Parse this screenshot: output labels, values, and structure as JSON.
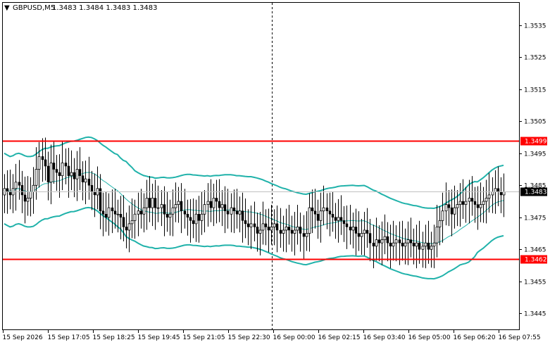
{
  "header": {
    "arrow": "▼",
    "symbol": "GBPUSD,M5",
    "quotes": "1.3483 1.3484 1.3483 1.3483"
  },
  "chart_data": {
    "type": "candlestick",
    "symbol": "GBPUSD",
    "timeframe": "M5",
    "last_quote": {
      "open": 1.3483,
      "high": 1.3484,
      "low": 1.3483,
      "close": 1.3483
    },
    "ylim": [
      1.344,
      1.3542
    ],
    "y_ticks": [
      "1.3535",
      "1.3525",
      "1.3515",
      "1.3505",
      "1.3495",
      "1.3485",
      "1.3475",
      "1.3465",
      "1.3455",
      "1.3445"
    ],
    "x_ticks": [
      "15 Sep 2026",
      "15 Sep 17:05",
      "15 Sep 18:25",
      "15 Sep 19:45",
      "15 Sep 21:05",
      "15 Sep 22:30",
      "16 Sep 00:00",
      "16 Sep 02:15",
      "16 Sep 03:40",
      "16 Sep 05:00",
      "16 Sep 06:20",
      "16 Sep 07:55"
    ],
    "levels": [
      {
        "value": 1.3499,
        "label": "1.3499",
        "color": "#ff0000"
      },
      {
        "value": 1.3462,
        "label": "1.3462",
        "color": "#ff0000"
      }
    ],
    "current_price": {
      "value": 1.3483,
      "label": "1.3483"
    },
    "close": [
      1.3484,
      1.3483,
      1.3482,
      1.3484,
      1.3486,
      1.3485,
      1.3482,
      1.348,
      1.3481,
      1.3483,
      1.3485,
      1.349,
      1.3494,
      1.3493,
      1.3491,
      1.3486,
      1.3492,
      1.349,
      1.3489,
      1.3488,
      1.3492,
      1.3491,
      1.3488,
      1.3489,
      1.3487,
      1.349,
      1.3488,
      1.3486,
      1.3487,
      1.3485,
      1.3483,
      1.3482,
      1.3484,
      1.3477,
      1.3476,
      1.3475,
      1.3478,
      1.3477,
      1.3476,
      1.3476,
      1.3475,
      1.3472,
      1.3471,
      1.3473,
      1.3474,
      1.3476,
      1.3477,
      1.3476,
      1.3478,
      1.3481,
      1.3478,
      1.3481,
      1.3478,
      1.3478,
      1.3479,
      1.3476,
      1.3475,
      1.3476,
      1.3478,
      1.3479,
      1.348,
      1.3477,
      1.3476,
      1.3475,
      1.3474,
      1.3473,
      1.3476,
      1.3474,
      1.3476,
      1.3479,
      1.348,
      1.3478,
      1.3481,
      1.348,
      1.3478,
      1.3479,
      1.3477,
      1.3476,
      1.3478,
      1.3477,
      1.3476,
      1.3477,
      1.3474,
      1.3473,
      1.3472,
      1.3473,
      1.3472,
      1.347,
      1.3471,
      1.3473,
      1.3472,
      1.3471,
      1.3472,
      1.3473,
      1.3471,
      1.347,
      1.3471,
      1.3472,
      1.3471,
      1.347,
      1.3471,
      1.3472,
      1.347,
      1.3469,
      1.347,
      1.3478,
      1.3477,
      1.3476,
      1.3474,
      1.3477,
      1.3478,
      1.3477,
      1.3476,
      1.3475,
      1.3474,
      1.3475,
      1.3474,
      1.3473,
      1.3472,
      1.3471,
      1.3472,
      1.347,
      1.3469,
      1.347,
      1.3471,
      1.347,
      1.3467,
      1.3466,
      1.3468,
      1.3467,
      1.3468,
      1.3469,
      1.3467,
      1.3466,
      1.3467,
      1.3468,
      1.3467,
      1.3466,
      1.3467,
      1.3468,
      1.3467,
      1.3466,
      1.3467,
      1.3465,
      1.3466,
      1.3467,
      1.3465,
      1.3466,
      1.3467,
      1.3472,
      1.3474,
      1.3477,
      1.3479,
      1.3478,
      1.3476,
      1.3478,
      1.3479,
      1.348,
      1.3479,
      1.348,
      1.3481,
      1.348,
      1.3479,
      1.3478,
      1.3479,
      1.348,
      1.3481,
      1.3482,
      1.3483,
      1.3484,
      1.3483,
      1.3482,
      1.3483
    ]
  }
}
